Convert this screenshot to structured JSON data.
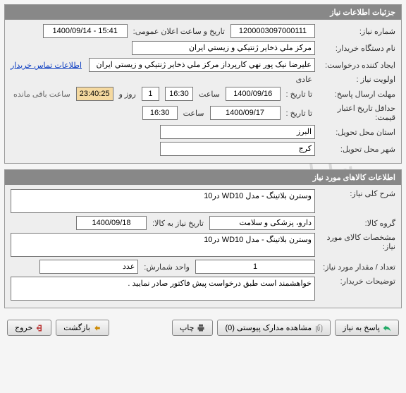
{
  "watermark": {
    "line1": "سامانه تدارکات الکترونیکی دولت",
    "line2": "۰۲۱-۴۱۹۳۴ | ۰۲۱-۸۸۲۴۸۷۰۵"
  },
  "panel1": {
    "title": "جزئیات اطلاعات نیاز",
    "need_number_label": "شماره نیاز:",
    "need_number": "1200003097000111",
    "announce_label": "تاریخ و ساعت اعلان عمومی:",
    "announce_value": "1400/09/14 - 15:41",
    "buyer_org_label": "نام دستگاه خریدار:",
    "buyer_org": "مرکز ملي ذخاير ژنتيكي و زيستي ايران",
    "creator_label": "ایجاد کننده درخواست:",
    "creator": "عليرضا نيک پور نهي کارپرداز مرکز ملي ذخاير ژنتيكي و زيستي ايران",
    "contact_link": "اطلاعات تماس خریدار",
    "priority_label": "اولویت نیاز :",
    "priority": "عادی",
    "deadline_send_label": "مهلت ارسال پاسخ:",
    "to_date_label": "تا تاریخ :",
    "deadline_date": "1400/09/16",
    "time_label": "ساعت",
    "deadline_time": "16:30",
    "days_count": "1",
    "days_and": "روز و",
    "remaining_time": "23:40:25",
    "remaining_suffix": "ساعت باقی مانده",
    "min_validity_label": "حداقل تاریخ اعتبار قیمت:",
    "validity_date": "1400/09/17",
    "validity_time": "16:30",
    "province_label": "استان محل تحویل:",
    "province": "البرز",
    "city_label": "شهر محل تحویل:",
    "city": "کرج"
  },
  "panel2": {
    "title": "اطلاعات کالاهای مورد نیاز",
    "general_desc_label": "شرح کلی نیاز:",
    "general_desc": "وسترن بلاتینگ - مدل WD10 در10",
    "group_label": "گروه کالا:",
    "group": "دارو، پزشکی و سلامت",
    "need_date_label": "تاریخ نیاز به کالا:",
    "need_date": "1400/09/18",
    "item_spec_label": "مشخصات کالای مورد نیاز:",
    "item_spec": "وسترن بلاتینگ - مدل WD10 در10",
    "qty_label": "تعداد / مقدار مورد نیاز:",
    "qty": "1",
    "unit_label": "واحد شمارش:",
    "unit": "عدد",
    "buyer_notes_label": "توضیحات خریدار:",
    "buyer_notes": "خواهشمند است طبق درخواست پیش فاکتور صادر نمایید ."
  },
  "footer": {
    "respond": "پاسخ به نیاز",
    "attachments": "مشاهده مدارک پیوستی (0)",
    "print": "چاپ",
    "back": "بازگشت",
    "exit": "خروج"
  }
}
